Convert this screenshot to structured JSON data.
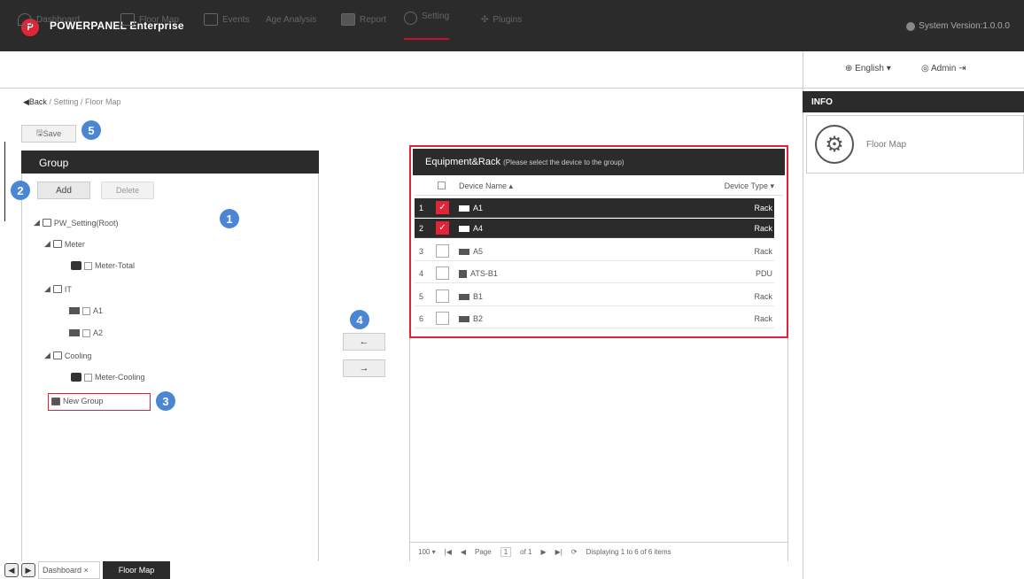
{
  "header": {
    "app_title": "POWERPANEL Enterprise",
    "logo_letter": "P",
    "system_version": "System Version:1.0.0.0"
  },
  "nav": {
    "items": [
      {
        "id": "dashboard",
        "label": "Dashboard"
      },
      {
        "id": "floormap",
        "label": "Floor Map"
      },
      {
        "id": "events",
        "label": "Events"
      },
      {
        "id": "analysis",
        "label": "Age Analysis"
      },
      {
        "id": "report",
        "label": "Report"
      },
      {
        "id": "setting",
        "label": "Setting",
        "active": true
      },
      {
        "id": "plugins",
        "label": "Plugins"
      }
    ],
    "language": "English",
    "user": "Admin"
  },
  "breadcrumb": {
    "back": "Back",
    "setting": "Setting",
    "current": "Floor Map"
  },
  "toolbar": {
    "save_label": "Save"
  },
  "markers": [
    "1",
    "2",
    "3",
    "4",
    "5"
  ],
  "group": {
    "title": "Group",
    "add_label": "Add",
    "delete_label": "Delete",
    "tree": {
      "root": "PW_Setting(Root)",
      "meter": "Meter",
      "meter_total": "Meter-Total",
      "it": "IT",
      "a1": "A1",
      "a2": "A2",
      "cooling": "Cooling",
      "meter_cooling": "Meter-Cooling",
      "new_group": "New Group"
    }
  },
  "transfer": {
    "left_arrow": "←",
    "right_arrow": "→"
  },
  "equipment": {
    "title": "Equipment&Rack",
    "subtitle": "(Please select the device to the group)",
    "col_name": "Device Name",
    "col_type": "Device Type",
    "rows": [
      {
        "num": "1",
        "name": "A1",
        "type": "Rack",
        "checked": true
      },
      {
        "num": "2",
        "name": "A4",
        "type": "Rack",
        "checked": true
      },
      {
        "num": "3",
        "name": "A5",
        "type": "Rack",
        "checked": false
      },
      {
        "num": "4",
        "name": "ATS-B1",
        "type": "PDU",
        "checked": false
      },
      {
        "num": "5",
        "name": "B1",
        "type": "Rack",
        "checked": false
      },
      {
        "num": "6",
        "name": "B2",
        "type": "Rack",
        "checked": false
      }
    ],
    "pager": {
      "page_size": "100",
      "page_label": "Page",
      "page_num": "1",
      "of_label": "of 1",
      "displaying": "Displaying 1 to 6 of 6 items"
    }
  },
  "info": {
    "title": "INFO",
    "label": "Floor Map"
  },
  "bottom": {
    "tab_dashboard": "Dashboard",
    "tab_floormap": "Floor Map"
  }
}
